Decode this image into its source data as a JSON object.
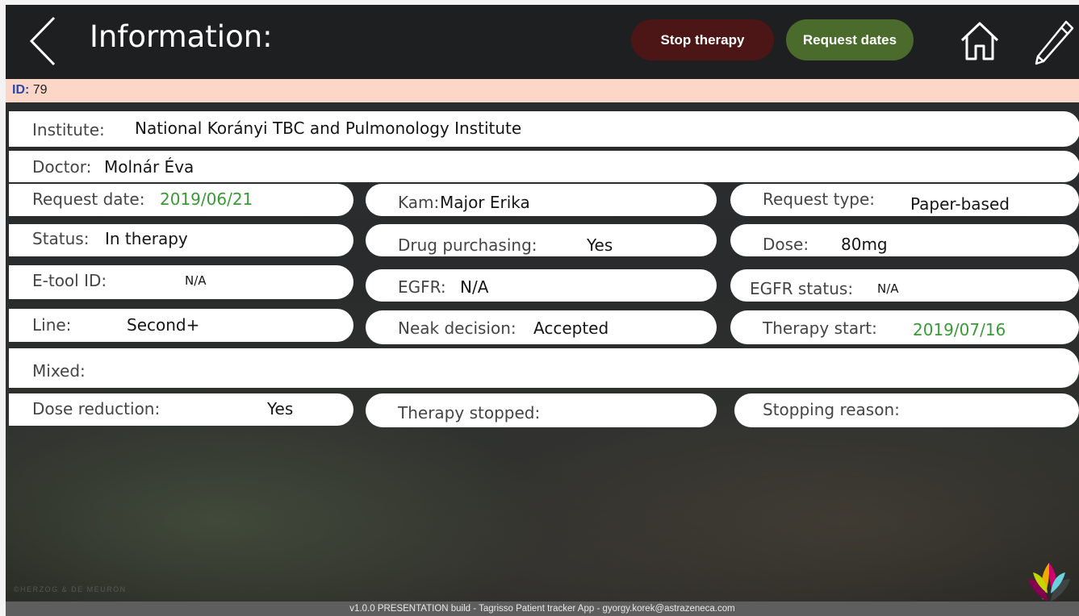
{
  "header": {
    "title": "Information:",
    "stop_therapy_label": "Stop therapy",
    "request_dates_label": "Request dates"
  },
  "id_bar": {
    "label": "ID:",
    "value": "79"
  },
  "fields": {
    "institute": {
      "label": "Institute:",
      "value": "National Korányi TBC and Pulmonology Institute"
    },
    "doctor": {
      "label": "Doctor:",
      "value": "Molnár Éva"
    },
    "request_date": {
      "label": "Request date:",
      "value": "2019/06/21"
    },
    "kam": {
      "label": "Kam:",
      "value": "Major Erika"
    },
    "request_type": {
      "label": "Request type:",
      "value": "Paper-based"
    },
    "status": {
      "label": "Status:",
      "value": "In therapy"
    },
    "drug_purchasing": {
      "label": "Drug purchasing:",
      "value": "Yes"
    },
    "dose": {
      "label": "Dose:",
      "value": "80mg"
    },
    "etool_id": {
      "label": "E-tool ID:",
      "value": "N/A"
    },
    "egfr": {
      "label": "EGFR:",
      "value": "N/A"
    },
    "egfr_status": {
      "label": "EGFR status:",
      "value": "N/A"
    },
    "line": {
      "label": "Line:",
      "value": "Second+"
    },
    "neak_decision": {
      "label": "Neak decision:",
      "value": "Accepted"
    },
    "therapy_start": {
      "label": "Therapy start:",
      "value": "2019/07/16"
    },
    "mixed": {
      "label": "Mixed:",
      "value": ""
    },
    "dose_reduction": {
      "label": "Dose reduction:",
      "value": "Yes"
    },
    "therapy_stopped": {
      "label": "Therapy stopped:",
      "value": ""
    },
    "stopping_reason": {
      "label": "Stopping reason:",
      "value": ""
    }
  },
  "footer": {
    "text": "v1.0.0 PRESENTATION build - Tagrisso Patient tracker App - gyorgy.korek@astrazeneca.com"
  },
  "watermark": "©HERZOG & DE MEURON",
  "colors": {
    "header_bg": "#1e1f21",
    "stop_therapy_bg": "#4c1616",
    "request_dates_bg": "#4a6b2c",
    "id_bar_bg": "#fcd6c6",
    "id_label": "#2f48a8",
    "date_green": "#3a9a36",
    "footer_bg": "#5e5e5e"
  },
  "icons": [
    "back-chevron-icon",
    "home-icon",
    "pencil-icon",
    "astrazeneca-logo"
  ]
}
